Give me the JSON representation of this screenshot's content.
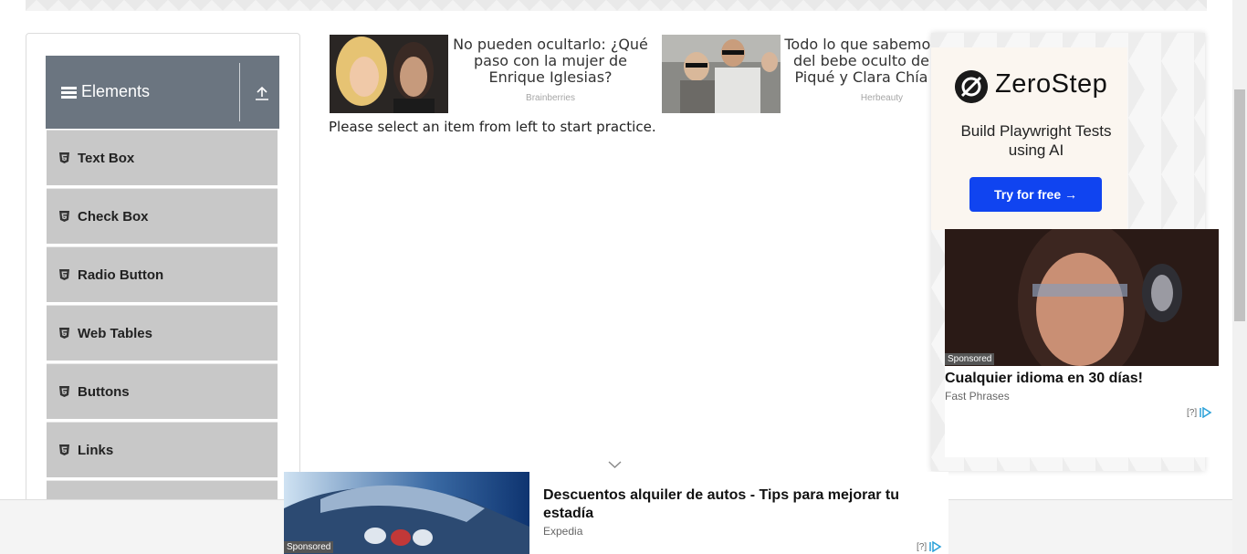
{
  "sidebar": {
    "group_title": "Elements",
    "items": [
      {
        "label": "Text Box"
      },
      {
        "label": "Check Box"
      },
      {
        "label": "Radio Button"
      },
      {
        "label": "Web Tables"
      },
      {
        "label": "Buttons"
      },
      {
        "label": "Links"
      }
    ]
  },
  "main": {
    "practice_text": "Please select an item from left to start practice."
  },
  "native_ads": [
    {
      "headline": "No pueden ocultarlo: ¿Qué paso con la mujer de Enrique Iglesias?",
      "source": "Brainberries"
    },
    {
      "headline": "Todo lo que sabemos del bebe oculto de Piqué y Clara Chía",
      "source": "Herbeauty"
    }
  ],
  "right_ad": {
    "brand": "ZeroStep",
    "tagline": "Build Playwright Tests using AI",
    "cta": "Try for free →",
    "card_sponsored": "Sponsored",
    "card_title": "Cualquier idioma en 30 días!",
    "card_source": "Fast Phrases",
    "adchoice": "[?]"
  },
  "bottom_ad": {
    "sponsored": "Sponsored",
    "title": "Descuentos alquiler de autos - Tips para mejorar tu estadía",
    "source": "Expedia",
    "adchoice": "[?]"
  },
  "colors": {
    "group_header": "#6b7580",
    "menu_item": "#c8c8c8",
    "cta_button": "#1044f0"
  }
}
